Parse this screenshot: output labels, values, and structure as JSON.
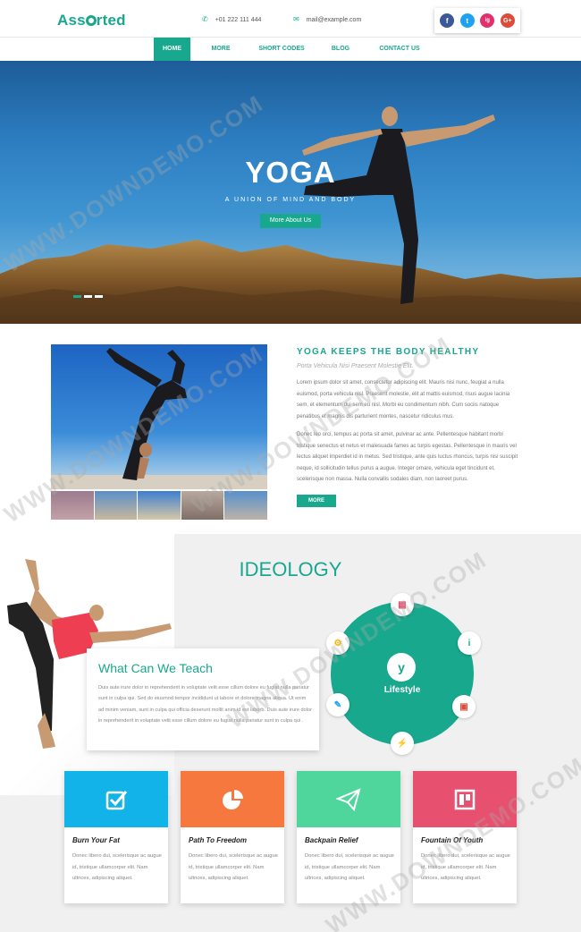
{
  "header": {
    "logo": "Assorted",
    "logo_pre": "Ass",
    "logo_post": "rted",
    "phone": "+01 222 111 444",
    "email": "mail@example.com",
    "social": [
      "f",
      "t",
      "ig",
      "G+"
    ]
  },
  "nav": {
    "items": [
      "HOME",
      "MORE",
      "SHORT CODES",
      "BLOG",
      "CONTACT US"
    ]
  },
  "hero": {
    "title": "YOGA",
    "subtitle": "A UNION OF MIND AND BODY",
    "button": "More About Us"
  },
  "about": {
    "title": "YOGA KEEPS THE BODY HEALTHY",
    "subtitle": "Porta Vehicula Nisi Praesent Molestie Elit.",
    "p1": "Lorem ipsum dolor sit amet, consectetur adipiscing elit. Mauris nisi nunc, feugiat a nulla euismod, porta vehicula nisl. Praesent molestie, elit at mattis euismod, risus augue lacinia sem, et elementum dui sem eu nisl. Morbi eu condimentum nibh. Cum sociis natoque penatibus et magnis dis parturient montes, nascetur ridiculus mus.",
    "p2": "Donec leo orci, tempus ac porta sit amet, pulvinar ac ante. Pellentesque habitant morbi tristique senectus et netus et malesuada fames ac turpis egestas. Pellentesque in mauris vel lectus aliquet imperdiet id in metus. Sed tristique, ante quis luctus rhoncus, turpis nisi suscipit neque, id sollicitudin tellus purus a augue. Integer ornare, vehicula eget tincidunt et, scelerisque non massa. Nulla convallis sodales diam, non laoreet purus.",
    "button": "MORE"
  },
  "ideology": {
    "title": "IDEOLOGY",
    "teach_title": "What Can We Teach",
    "teach_text": "Duis aute irure dolor in reprehenderit in voluptate velit esse cillum dolore eu fugiat nulla pariatur sunt in culpa qui. Sed do eiusmod tempor incididunt ut labore et dolore magna aliqua. Ut enim ad minim veniam, sunt in culpa qui officia deserunt mollit anim id est laborb. Duis aute irure dolor in reprehenderit in voluptate velit esse cillum dolore eu fugiat nulla pariatur sunt in culpa qui .",
    "wheel_label": "Lifestyle"
  },
  "cards": [
    {
      "title": "Burn Your Fat",
      "text": "Donec libero dui, scelerisque ac augue id, tristique ullamcorper elit. Nam ultrices, adipiscing aliquet.",
      "color": "#11b3e8",
      "icon": "checkbox-icon"
    },
    {
      "title": "Path To Freedom",
      "text": "Donec libero dui, scelerisque ac augue id, tristique ullamcorper elit. Nam ultrices, adipiscing aliquet.",
      "color": "#f7783e",
      "icon": "pie-chart-icon"
    },
    {
      "title": "Backpain Relief",
      "text": "Donec libero dui, scelerisque ac augue id, tristique ullamcorper elit. Nam ultrices, adipiscing aliquet.",
      "color": "#4fd69c",
      "icon": "paper-plane-icon"
    },
    {
      "title": "Fountain Of Youth",
      "text": "Donec libero dui, scelerisque ac augue id, tristique ullamcorper elit. Nam ultrices, adipiscing aliquet.",
      "color": "#e8506f",
      "icon": "trello-icon"
    }
  ],
  "colors": {
    "accent": "#18a88d",
    "facebook": "#3b5998",
    "twitter": "#1da1f2",
    "instagram": "#e1306c",
    "google": "#dd4b39"
  },
  "watermark": "WWW.DOWNDEMO.COM"
}
